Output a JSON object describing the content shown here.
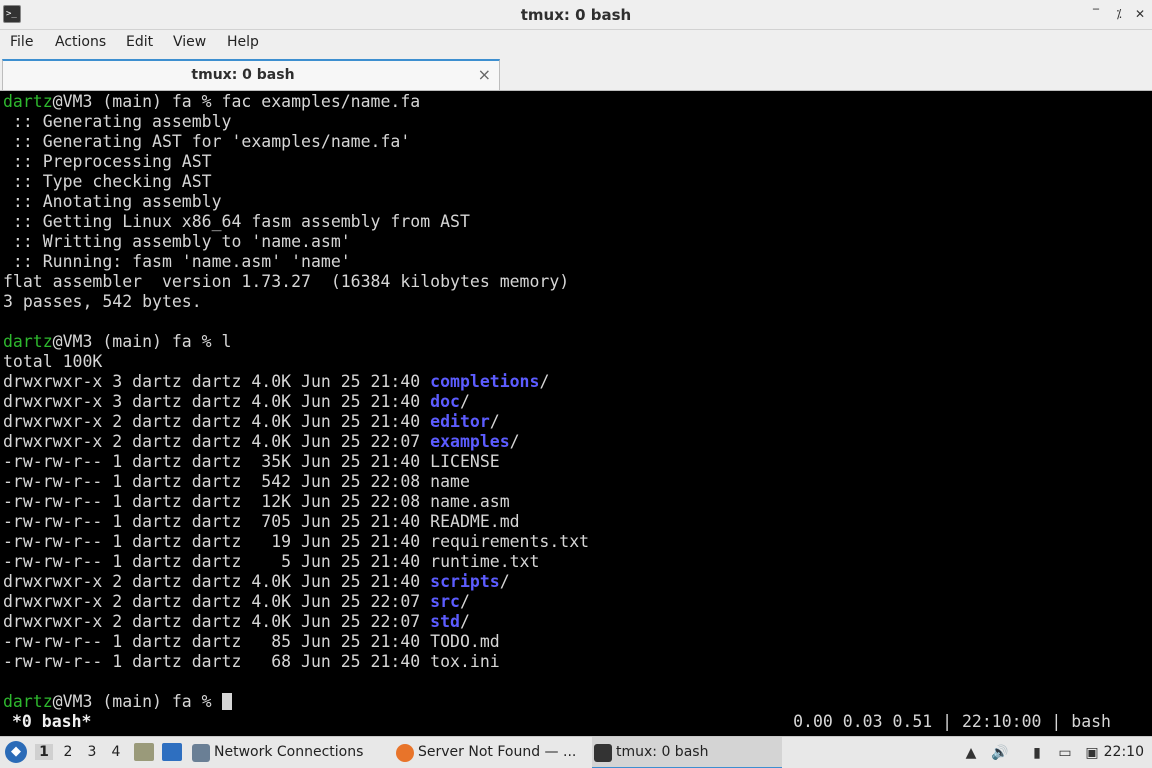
{
  "window": {
    "title": "tmux: 0 bash",
    "icon_name": "terminal-icon",
    "controls": {
      "minimize": "‾",
      "restore": "⁒",
      "close": "✕"
    }
  },
  "menu": [
    "File",
    "Actions",
    "Edit",
    "View",
    "Help"
  ],
  "tab": {
    "title": "tmux: 0 bash",
    "close": "×"
  },
  "terminal": {
    "lines": [
      [
        {
          "t": "dartz",
          "c": "user"
        },
        {
          "t": "@VM3 (main) fa % fac examples/name.fa"
        }
      ],
      [
        {
          "t": " :: Generating assembly"
        }
      ],
      [
        {
          "t": " :: Generating AST for 'examples/name.fa'"
        }
      ],
      [
        {
          "t": " :: Preprocessing AST"
        }
      ],
      [
        {
          "t": " :: Type checking AST"
        }
      ],
      [
        {
          "t": " :: Anotating assembly"
        }
      ],
      [
        {
          "t": " :: Getting Linux x86_64 fasm assembly from AST"
        }
      ],
      [
        {
          "t": " :: Writting assembly to 'name.asm'"
        }
      ],
      [
        {
          "t": " :: Running: fasm 'name.asm' 'name'"
        }
      ],
      [
        {
          "t": "flat assembler  version 1.73.27  (16384 kilobytes memory)"
        }
      ],
      [
        {
          "t": "3 passes, 542 bytes."
        }
      ],
      [
        {
          "t": ""
        }
      ],
      [
        {
          "t": "dartz",
          "c": "user"
        },
        {
          "t": "@VM3 (main) fa % l"
        }
      ],
      [
        {
          "t": "total 100K"
        }
      ],
      [
        {
          "t": "drwxrwxr-x 3 dartz dartz 4.0K Jun 25 21:40 "
        },
        {
          "t": "completions",
          "c": "dir"
        },
        {
          "t": "/"
        }
      ],
      [
        {
          "t": "drwxrwxr-x 3 dartz dartz 4.0K Jun 25 21:40 "
        },
        {
          "t": "doc",
          "c": "dir"
        },
        {
          "t": "/"
        }
      ],
      [
        {
          "t": "drwxrwxr-x 2 dartz dartz 4.0K Jun 25 21:40 "
        },
        {
          "t": "editor",
          "c": "dir"
        },
        {
          "t": "/"
        }
      ],
      [
        {
          "t": "drwxrwxr-x 2 dartz dartz 4.0K Jun 25 22:07 "
        },
        {
          "t": "examples",
          "c": "dir"
        },
        {
          "t": "/"
        }
      ],
      [
        {
          "t": "-rw-rw-r-- 1 dartz dartz  35K Jun 25 21:40 LICENSE"
        }
      ],
      [
        {
          "t": "-rw-rw-r-- 1 dartz dartz  542 Jun 25 22:08 name"
        }
      ],
      [
        {
          "t": "-rw-rw-r-- 1 dartz dartz  12K Jun 25 22:08 name.asm"
        }
      ],
      [
        {
          "t": "-rw-rw-r-- 1 dartz dartz  705 Jun 25 21:40 README.md"
        }
      ],
      [
        {
          "t": "-rw-rw-r-- 1 dartz dartz   19 Jun 25 21:40 requirements.txt"
        }
      ],
      [
        {
          "t": "-rw-rw-r-- 1 dartz dartz    5 Jun 25 21:40 runtime.txt"
        }
      ],
      [
        {
          "t": "drwxrwxr-x 2 dartz dartz 4.0K Jun 25 21:40 "
        },
        {
          "t": "scripts",
          "c": "dir"
        },
        {
          "t": "/"
        }
      ],
      [
        {
          "t": "drwxrwxr-x 2 dartz dartz 4.0K Jun 25 22:07 "
        },
        {
          "t": "src",
          "c": "dir"
        },
        {
          "t": "/"
        }
      ],
      [
        {
          "t": "drwxrwxr-x 2 dartz dartz 4.0K Jun 25 22:07 "
        },
        {
          "t": "std",
          "c": "dir"
        },
        {
          "t": "/"
        }
      ],
      [
        {
          "t": "-rw-rw-r-- 1 dartz dartz   85 Jun 25 21:40 TODO.md"
        }
      ],
      [
        {
          "t": "-rw-rw-r-- 1 dartz dartz   68 Jun 25 21:40 tox.ini"
        }
      ],
      [
        {
          "t": ""
        }
      ],
      [
        {
          "t": "dartz",
          "c": "user"
        },
        {
          "t": "@VM3 (main) fa % "
        }
      ]
    ],
    "status_left": "*0 bash*",
    "status_right": "0.00 0.03 0.51 | 22:10:00 | bash",
    "colors": {
      "user": "#2eb82e",
      "dir": "#5c5cff",
      "text": "#d6d6d6",
      "bg": "#000000"
    }
  },
  "taskbar": {
    "workspaces": [
      "1",
      "2",
      "3",
      "4"
    ],
    "active_workspace": "1",
    "tasks": [
      {
        "label": "Network Connections",
        "icon": "network-icon"
      },
      {
        "label": "Server Not Found — ...",
        "icon": "firefox-icon"
      },
      {
        "label": "tmux: 0 bash",
        "icon": "terminal-icon"
      }
    ],
    "clock": "22:10"
  }
}
